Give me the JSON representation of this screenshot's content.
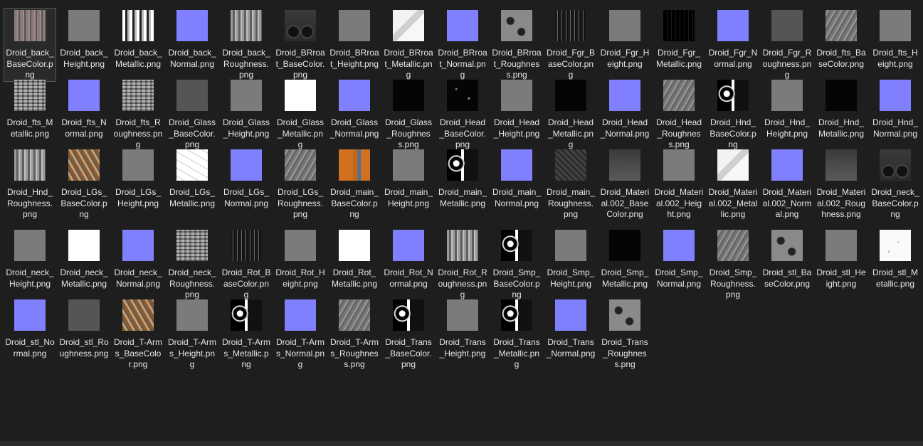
{
  "files": [
    {
      "name": "Droid_back_BaseColor.png",
      "thumb": "t-pinkback",
      "selected": true
    },
    {
      "name": "Droid_back_Height.png",
      "thumb": "t-gray"
    },
    {
      "name": "Droid_back_Metallic.png",
      "thumb": "t-bw"
    },
    {
      "name": "Droid_back_Normal.png",
      "thumb": "t-normal"
    },
    {
      "name": "Droid_back_Roughness.png",
      "thumb": "t-noise"
    },
    {
      "name": "Droid_BRroat_BaseColor.png",
      "thumb": "t-darkpanel"
    },
    {
      "name": "Droid_BRroat_Height.png",
      "thumb": "t-gray"
    },
    {
      "name": "Droid_BRroat_Metallic.png",
      "thumb": "t-mostwhite"
    },
    {
      "name": "Droid_BRroat_Normal.png",
      "thumb": "t-normal"
    },
    {
      "name": "Droid_BRroat_Roughness.png",
      "thumb": "t-circles"
    },
    {
      "name": "Droid_Fgr_BaseColor.png",
      "thumb": "t-stripes"
    },
    {
      "name": "Droid_Fgr_Height.png",
      "thumb": "t-gray"
    },
    {
      "name": "Droid_Fgr_Metallic.png",
      "thumb": "t-blackdetail"
    },
    {
      "name": "Droid_Fgr_Normal.png",
      "thumb": "t-normal"
    },
    {
      "name": "Droid_Fgr_Roughness.png",
      "thumb": "t-dgray"
    },
    {
      "name": "Droid_fts_BaseColor.png",
      "thumb": "t-grunge"
    },
    {
      "name": "Droid_fts_Height.png",
      "thumb": "t-gray"
    },
    {
      "name": "Droid_fts_Metallic.png",
      "thumb": "t-noise2"
    },
    {
      "name": "Droid_fts_Normal.png",
      "thumb": "t-normal"
    },
    {
      "name": "Droid_fts_Roughness.png",
      "thumb": "t-noise2"
    },
    {
      "name": "Droid_Glass_BaseColor.png",
      "thumb": "t-dgray"
    },
    {
      "name": "Droid_Glass_Height.png",
      "thumb": "t-gray"
    },
    {
      "name": "Droid_Glass_Metallic.png",
      "thumb": "t-white"
    },
    {
      "name": "Droid_Glass_Normal.png",
      "thumb": "t-normal"
    },
    {
      "name": "Droid_Glass_Roughness.png",
      "thumb": "t-black"
    },
    {
      "name": "Droid_Head_BaseColor.png",
      "thumb": "t-blackdots"
    },
    {
      "name": "Droid_Head_Height.png",
      "thumb": "t-gray"
    },
    {
      "name": "Droid_Head_Metallic.png",
      "thumb": "t-black"
    },
    {
      "name": "Droid_Head_Normal.png",
      "thumb": "t-normal"
    },
    {
      "name": "Droid_Head_Roughness.png",
      "thumb": "t-grunge"
    },
    {
      "name": "Droid_Hnd_BaseColor.png",
      "thumb": "t-blackbw"
    },
    {
      "name": "Droid_Hnd_Height.png",
      "thumb": "t-gray"
    },
    {
      "name": "Droid_Hnd_Metallic.png",
      "thumb": "t-black"
    },
    {
      "name": "Droid_Hnd_Normal.png",
      "thumb": "t-normal"
    },
    {
      "name": "Droid_Hnd_Roughness.png",
      "thumb": "t-noise"
    },
    {
      "name": "Droid_LGs_BaseColor.png",
      "thumb": "t-brown"
    },
    {
      "name": "Droid_LGs_Height.png",
      "thumb": "t-gray"
    },
    {
      "name": "Droid_LGs_Metallic.png",
      "thumb": "t-sketch"
    },
    {
      "name": "Droid_LGs_Normal.png",
      "thumb": "t-normal"
    },
    {
      "name": "Droid_LGs_Roughness.png",
      "thumb": "t-grunge"
    },
    {
      "name": "Droid_main_BaseColor.png",
      "thumb": "t-orange"
    },
    {
      "name": "Droid_main_Height.png",
      "thumb": "t-gray"
    },
    {
      "name": "Droid_main_Metallic.png",
      "thumb": "t-blackbw"
    },
    {
      "name": "Droid_main_Normal.png",
      "thumb": "t-normal"
    },
    {
      "name": "Droid_main_Roughness.png",
      "thumb": "t-dark"
    },
    {
      "name": "Droid_Material.002_BaseColor.png",
      "thumb": "t-gradient"
    },
    {
      "name": "Droid_Material.002_Height.png",
      "thumb": "t-gray"
    },
    {
      "name": "Droid_Material.002_Metallic.png",
      "thumb": "t-mostwhite"
    },
    {
      "name": "Droid_Material.002_Normal.png",
      "thumb": "t-normal"
    },
    {
      "name": "Droid_Material.002_Roughness.png",
      "thumb": "t-gradient"
    },
    {
      "name": "Droid_neck_BaseColor.png",
      "thumb": "t-darkpanel"
    },
    {
      "name": "Droid_neck_Height.png",
      "thumb": "t-gray"
    },
    {
      "name": "Droid_neck_Metallic.png",
      "thumb": "t-white"
    },
    {
      "name": "Droid_neck_Normal.png",
      "thumb": "t-normal"
    },
    {
      "name": "Droid_neck_Roughness.png",
      "thumb": "t-noise2"
    },
    {
      "name": "Droid_Rot_BaseColor.png",
      "thumb": "t-stripes"
    },
    {
      "name": "Droid_Rot_Height.png",
      "thumb": "t-gray"
    },
    {
      "name": "Droid_Rot_Metallic.png",
      "thumb": "t-white"
    },
    {
      "name": "Droid_Rot_Normal.png",
      "thumb": "t-normal"
    },
    {
      "name": "Droid_Rot_Roughness.png",
      "thumb": "t-noise"
    },
    {
      "name": "Droid_Smp_BaseColor.png",
      "thumb": "t-blackbw"
    },
    {
      "name": "Droid_Smp_Height.png",
      "thumb": "t-gray"
    },
    {
      "name": "Droid_Smp_Metallic.png",
      "thumb": "t-black"
    },
    {
      "name": "Droid_Smp_Normal.png",
      "thumb": "t-normal"
    },
    {
      "name": "Droid_Smp_Roughness.png",
      "thumb": "t-grunge"
    },
    {
      "name": "Droid_stl_BaseColor.png",
      "thumb": "t-circles"
    },
    {
      "name": "Droid_stl_Height.png",
      "thumb": "t-gray"
    },
    {
      "name": "Droid_stl_Metallic.png",
      "thumb": "t-speckwhite"
    },
    {
      "name": "Droid_stl_Normal.png",
      "thumb": "t-normal"
    },
    {
      "name": "Droid_stl_Roughness.png",
      "thumb": "t-dgray"
    },
    {
      "name": "Droid_T-Arms_BaseColor.png",
      "thumb": "t-brown"
    },
    {
      "name": "Droid_T-Arms_Height.png",
      "thumb": "t-gray"
    },
    {
      "name": "Droid_T-Arms_Metallic.png",
      "thumb": "t-blackbw"
    },
    {
      "name": "Droid_T-Arms_Normal.png",
      "thumb": "t-normal"
    },
    {
      "name": "Droid_T-Arms_Roughness.png",
      "thumb": "t-grunge"
    },
    {
      "name": "Droid_Trans_BaseColor.png",
      "thumb": "t-blackbw"
    },
    {
      "name": "Droid_Trans_Height.png",
      "thumb": "t-gray"
    },
    {
      "name": "Droid_Trans_Metallic.png",
      "thumb": "t-blackbw"
    },
    {
      "name": "Droid_Trans_Normal.png",
      "thumb": "t-normal"
    },
    {
      "name": "Droid_Trans_Roughness.png",
      "thumb": "t-circles"
    }
  ]
}
